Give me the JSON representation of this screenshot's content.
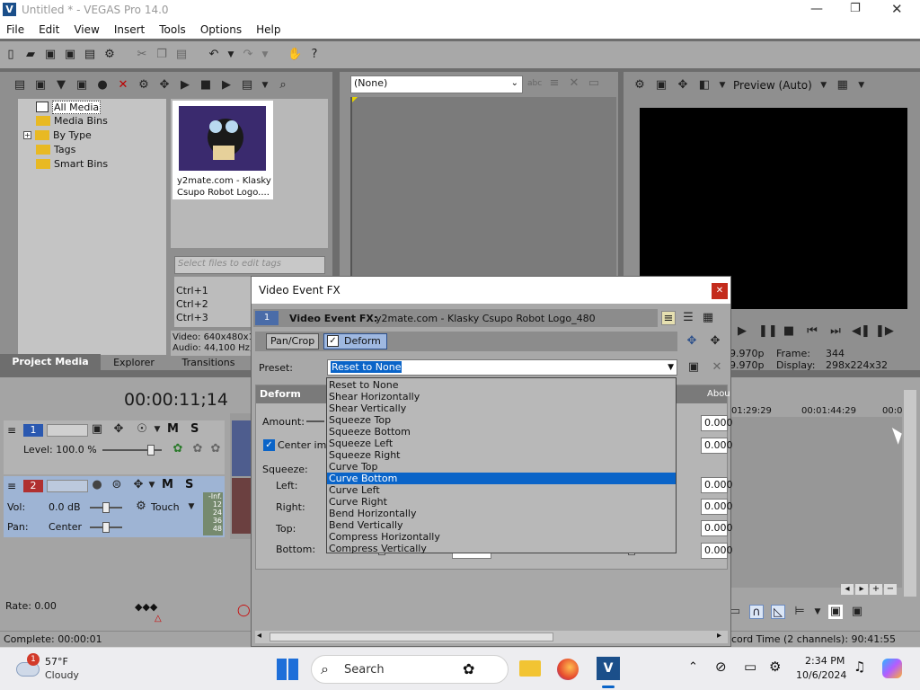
{
  "window": {
    "title": "Untitled * - VEGAS Pro 14.0"
  },
  "menu": [
    "File",
    "Edit",
    "View",
    "Insert",
    "Tools",
    "Options",
    "Help"
  ],
  "media": {
    "tree": [
      "All Media",
      "Media Bins",
      "By Type",
      "Tags",
      "Smart Bins"
    ],
    "thumb_caption_1": "y2mate.com - Klasky",
    "thumb_caption_2": "Csupo Robot Logo....",
    "tag_placeholder": "Select files to edit tags",
    "ctrl": [
      "Ctrl+1",
      "Ctrl+2",
      "Ctrl+3"
    ],
    "info_video": "Video: 640x480x1",
    "info_audio": "Audio: 44,100 Hz,",
    "tabs": [
      "Project Media",
      "Explorer",
      "Transitions"
    ]
  },
  "trimmer": {
    "select_value": "(None)"
  },
  "preview": {
    "mode": "Preview (Auto)",
    "left1": "9.970p",
    "left2": "9.970p",
    "frame_label": "Frame:",
    "frame_value": "344",
    "display_label": "Display:",
    "display_value": "298x224x32"
  },
  "timeline": {
    "time": "00:00:11;14",
    "ruler_marks": [
      "00:0",
      "01:29:29",
      "00:01:44:29",
      "00:0"
    ],
    "track1": {
      "num": "1",
      "level": "Level: 100.0 %",
      "m": "M",
      "s": "S"
    },
    "track2": {
      "num": "2",
      "vol_label": "Vol:",
      "vol_value": "0.0 dB",
      "pan_label": "Pan:",
      "pan_value": "Center",
      "touch": "Touch",
      "m": "M",
      "s": "S",
      "meter_labels": [
        "-Inf.",
        "12",
        "24",
        "36",
        "48"
      ]
    },
    "rate": "Rate: 0.00",
    "status": "Complete: 00:00:01",
    "record_time": "cord Time (2 channels): 90:41:55"
  },
  "fx_dialog": {
    "title": "Video Event FX",
    "badge": "1",
    "header_label": "Video Event FX:",
    "header_value": "y2mate.com - Klasky Csupo Robot Logo_480",
    "chain": [
      "Pan/Crop",
      "Deform"
    ],
    "preset_label": "Preset:",
    "preset_value": "Reset to None",
    "section": "Deform",
    "about": "Abou",
    "amount_label": "Amount:",
    "center_label": "Center imag",
    "squeeze_label": "Squeeze:",
    "left_label": "Left:",
    "right_label": "Right:",
    "top_label": "Top:",
    "bottom_label": "Bottom:",
    "bottom_right_label": "Bottom:",
    "values": [
      "0.000",
      "0.000",
      "0.000",
      "0.000",
      "0.000",
      "0.000"
    ],
    "bottom_value": "0.000",
    "options": [
      "Reset to None",
      "Shear Horizontally",
      "Shear Vertically",
      "Squeeze Top",
      "Squeeze Bottom",
      "Squeeze Left",
      "Squeeze Right",
      "Curve Top",
      "Curve Bottom",
      "Curve Left",
      "Curve Right",
      "Bend Horizontally",
      "Bend Vertically",
      "Compress Horizontally",
      "Compress Vertically"
    ],
    "selected_index": 8
  },
  "taskbar": {
    "weather_badge": "1",
    "temp": "57°F",
    "condition": "Cloudy",
    "search": "Search",
    "time": "2:34 PM",
    "date": "10/6/2024"
  }
}
